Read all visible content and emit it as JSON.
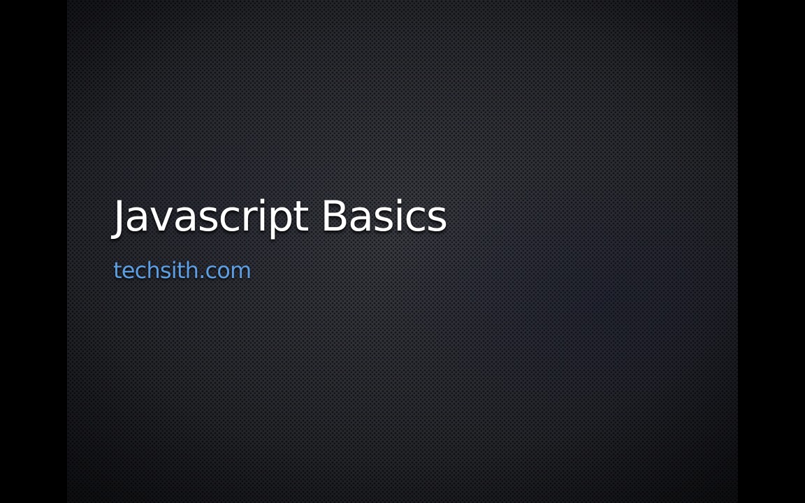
{
  "slide": {
    "title": "Javascript Basics",
    "subtitle": "techsith.com",
    "colors": {
      "title": "#ffffff",
      "subtitle": "#5d9ee2",
      "background": "#26272c",
      "letterbox": "#000000"
    }
  }
}
